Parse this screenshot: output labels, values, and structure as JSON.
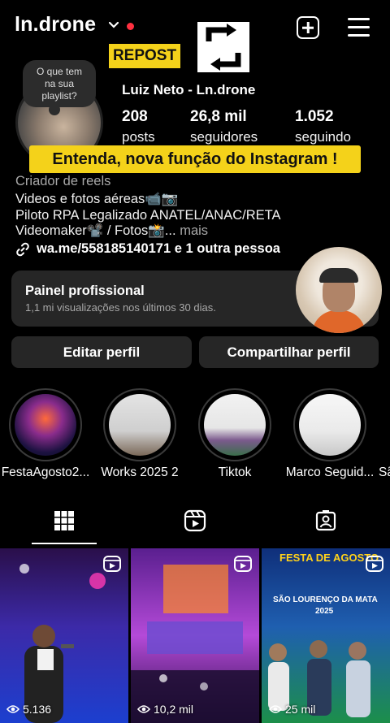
{
  "header": {
    "username": "ln.drone"
  },
  "overlay": {
    "repost_label": "REPOST",
    "banner_text": "Entenda, nova função do Instagram !"
  },
  "profile": {
    "note": [
      "O que tem",
      "na sua",
      "playlist?"
    ],
    "display_name": "Luiz Neto - Ln.drone",
    "stats": [
      {
        "value": "208",
        "label": "posts"
      },
      {
        "value": "26,8 mil",
        "label": "seguidores"
      },
      {
        "value": "1.052",
        "label": "seguindo"
      }
    ],
    "category": "Criador de reels",
    "bio_lines": [
      "Videos e fotos aéreas📹📷",
      "Piloto RPA Legalizado ANATEL/ANAC/RETA",
      "Videomaker📽️ / Fotos📸..."
    ],
    "more_label": "mais",
    "link_text": "wa.me/558185140171 e 1 outra pessoa"
  },
  "dashboard": {
    "title": "Painel profissional",
    "subtitle": "1,1 mi visualizações nos últimos 30 dias."
  },
  "actions": {
    "edit_label": "Editar perfil",
    "share_label": "Compartilhar perfil"
  },
  "highlights": [
    {
      "label": "FestaAgosto2..."
    },
    {
      "label": "Works 2025 2"
    },
    {
      "label": "Tiktok"
    },
    {
      "label": "Marco Seguid..."
    },
    {
      "label": "Sã"
    }
  ],
  "grid": [
    {
      "views": "5.136"
    },
    {
      "views": "10,2 mil"
    },
    {
      "views": "25 mil",
      "title": "FESTA DE AGOSTO",
      "subtitle": "SÃO LOURENÇO DA MATA",
      "year": "2025"
    }
  ],
  "colors": {
    "accent_yellow": "#f4d21a",
    "notification_red": "#ff3040",
    "card_bg": "#262626"
  }
}
